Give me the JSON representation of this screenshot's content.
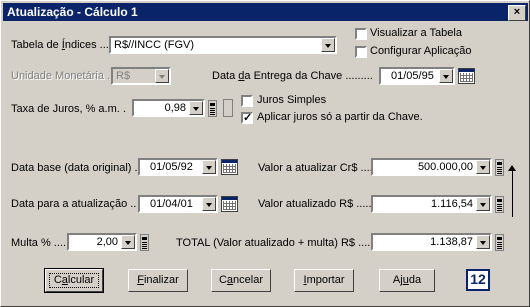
{
  "window": {
    "title": "Atualização - Cálculo 1",
    "close_label": "×"
  },
  "tabela": {
    "label_pre": "Tabela de ",
    "label_u": "Í",
    "label_post": "ndices ...",
    "value": "R$//INCC (FGV)"
  },
  "checks": {
    "visualizar": {
      "label": "Visualizar a Tabela",
      "checked": false
    },
    "configurar": {
      "label": "Configurar Aplicação",
      "checked": false
    },
    "juros_simples": {
      "label": "Juros Simples",
      "checked": false
    },
    "aplicar_juros": {
      "label": "Aplicar juros só a partir da Chave.",
      "checked": true
    }
  },
  "unidade": {
    "label": "Unidade Monetária .",
    "value": "R$"
  },
  "data_entrega": {
    "label_pre": "Data ",
    "label_u": "d",
    "label_post": "a Entrega da Chave .........",
    "value": "01/05/95"
  },
  "taxa": {
    "label": "Taxa de Juros, % a.m. .",
    "value": "0,98"
  },
  "data_base": {
    "label": "Data base (data original) .",
    "value": "01/05/92"
  },
  "valor_atualizar": {
    "label": "Valor a atualizar Cr$ ....",
    "value": "500.000,00"
  },
  "data_atualizacao": {
    "label": "Data para a atualização ..",
    "value": "01/04/01"
  },
  "valor_atualizado": {
    "label": "Valor atualizado  R$ .....",
    "value": "1.116,54"
  },
  "multa": {
    "label": "Multa % ....",
    "value": "2,00"
  },
  "total": {
    "label": "TOTAL (Valor atualizado + multa)  R$ ....",
    "value": "1.138,87"
  },
  "buttons": {
    "calcular": {
      "u": "a",
      "pre": "C",
      "post": "lcular"
    },
    "finalizar": {
      "u": "F",
      "pre": "",
      "post": "inalizar"
    },
    "cancelar": {
      "u": "a",
      "pre": "C",
      "post": "ncelar"
    },
    "importar": {
      "u": "I",
      "pre": "",
      "post": "mportar"
    },
    "ajuda": {
      "u": "u",
      "pre": "Aj",
      "post": "da"
    }
  },
  "help_icon_text": "12"
}
